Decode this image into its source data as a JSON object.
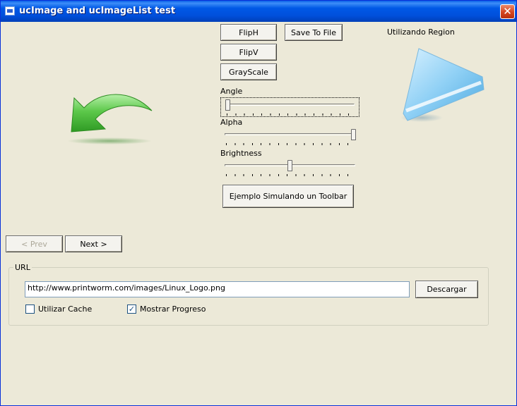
{
  "window": {
    "title": "ucImage and ucImageList test",
    "close_glyph": "✕"
  },
  "toolbar": {
    "fliph": "FlipH",
    "save_to_file": "Save To File",
    "flipv": "FlipV",
    "grayscale": "GrayScale",
    "toolbar_example": "Ejemplo Simulando un Toolbar"
  },
  "region_label": "Utilizando Region",
  "sliders": {
    "angle": {
      "label": "Angle",
      "value": 0.02
    },
    "alpha": {
      "label": "Alpha",
      "value": 1.0
    },
    "brightness": {
      "label": "Brightness",
      "value": 0.5
    }
  },
  "nav": {
    "prev": "< Prev",
    "next": "Next >"
  },
  "url_group": {
    "label": "URL",
    "url_value": "http://www.printworm.com/images/Linux_Logo.png",
    "download": "Descargar",
    "use_cache": {
      "label": "Utilizar Cache",
      "checked": false
    },
    "show_progress": {
      "label": "Mostrar Progreso",
      "checked": true
    }
  },
  "icons": {
    "left_image": "green-back-arrow-icon",
    "right_image": "blue-play-triangle-icon",
    "colors": {
      "arrow_green": "#5cc84a",
      "triangle_blue": "#8fd0f5",
      "titlebar_blue": "#0058e6",
      "close_red": "#d4441f"
    }
  }
}
